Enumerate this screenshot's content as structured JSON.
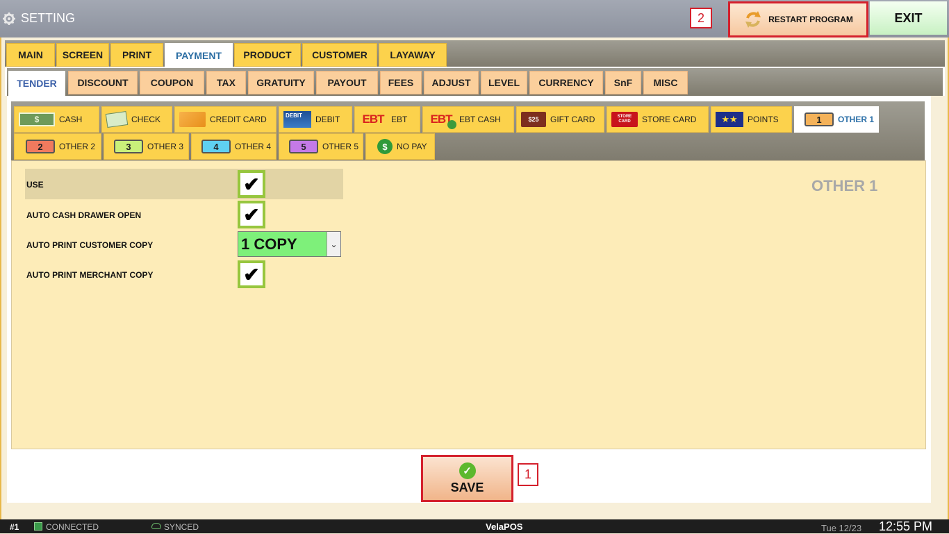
{
  "window": {
    "title": "SETTING",
    "restart_label": "RESTART PROGRAM",
    "exit_label": "EXIT",
    "marker_restart": "2",
    "marker_save": "1"
  },
  "main_tabs": [
    "MAIN",
    "SCREEN",
    "PRINT",
    "PAYMENT",
    "PRODUCT",
    "CUSTOMER",
    "LAYAWAY"
  ],
  "payment_tabs": [
    "TENDER",
    "DISCOUNT",
    "COUPON",
    "TAX",
    "GRATUITY",
    "PAYOUT",
    "FEES",
    "ADJUST",
    "LEVEL",
    "CURRENCY",
    "SnF",
    "MISC"
  ],
  "tenders_row1": [
    "CASH",
    "CHECK",
    "CREDIT CARD",
    "DEBIT",
    "EBT",
    "EBT CASH",
    "GIFT CARD",
    "STORE CARD",
    "POINTS",
    "OTHER 1"
  ],
  "tenders_row2": [
    "OTHER 2",
    "OTHER 3",
    "OTHER 4",
    "OTHER 5",
    "NO PAY"
  ],
  "icon_text": {
    "debit": "DEBIT",
    "ebt": "EBT",
    "gift": "$25",
    "store": "STORE CARD",
    "n1": "1",
    "n2": "2",
    "n3": "3",
    "n4": "4",
    "n5": "5"
  },
  "settings": {
    "section_title": "OTHER 1",
    "use_label": "USE",
    "drawer_label": "AUTO CASH DRAWER OPEN",
    "customer_copy_label": "AUTO PRINT CUSTOMER COPY",
    "customer_copy_value": "1 COPY",
    "merchant_copy_label": "AUTO PRINT MERCHANT COPY",
    "use_checked": true,
    "drawer_checked": true,
    "merchant_checked": true,
    "check_glyph": "✔"
  },
  "save_label": "SAVE",
  "status": {
    "station": "#1",
    "connected": "CONNECTED",
    "synced": "SYNCED",
    "brand": "VelaPOS",
    "date": "Tue 12/23",
    "time": "12:55 PM"
  },
  "colors": {
    "accent_red": "#d4202c",
    "check_green": "#97c63e",
    "select_green": "#7ef07a"
  }
}
